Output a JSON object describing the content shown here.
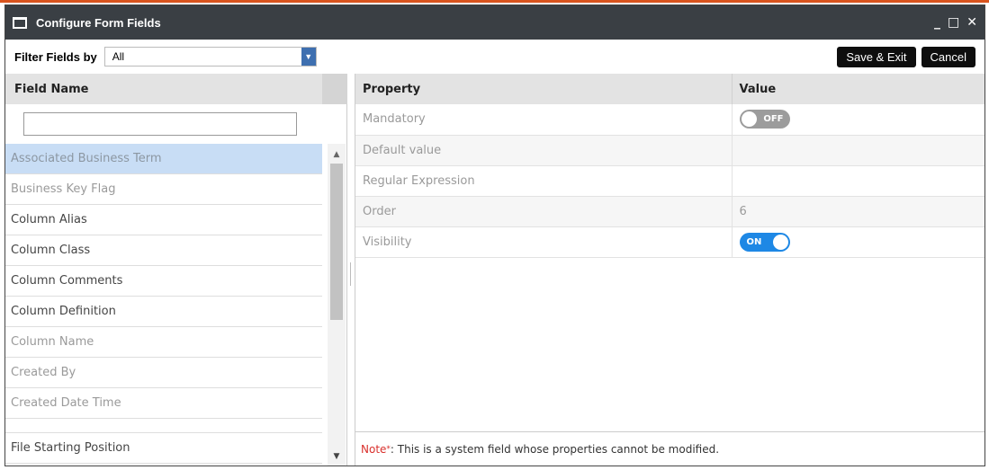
{
  "window": {
    "title": "Configure Form Fields",
    "minimize_glyph": "_",
    "maximize_glyph": "□",
    "close_glyph": "✕"
  },
  "toolbar": {
    "filter_label": "Filter Fields by",
    "filter_value": "All",
    "save_exit_label": "Save & Exit",
    "cancel_label": "Cancel"
  },
  "fields_panel": {
    "header": "Field Name",
    "search_value": "",
    "items": [
      {
        "label": "Associated Business Term",
        "state": "selected"
      },
      {
        "label": "Business Key Flag",
        "state": "muted"
      },
      {
        "label": "Column Alias",
        "state": "normal"
      },
      {
        "label": "Column Class",
        "state": "normal"
      },
      {
        "label": "Column Comments",
        "state": "normal"
      },
      {
        "label": "Column Definition",
        "state": "normal"
      },
      {
        "label": "Column Name",
        "state": "muted"
      },
      {
        "label": "Created By",
        "state": "muted"
      },
      {
        "label": "Created Date Time",
        "state": "muted"
      },
      {
        "label": "File Starting Position",
        "state": "normal"
      }
    ]
  },
  "properties": {
    "header_property": "Property",
    "header_value": "Value",
    "rows": [
      {
        "name": "Mandatory",
        "value": "OFF",
        "kind": "toggle-off"
      },
      {
        "name": "Default value",
        "value": "",
        "kind": "text"
      },
      {
        "name": "Regular Expression",
        "value": "",
        "kind": "text"
      },
      {
        "name": "Order",
        "value": "6",
        "kind": "text"
      },
      {
        "name": "Visibility",
        "value": "ON",
        "kind": "toggle-on"
      }
    ]
  },
  "note": {
    "label": "Note",
    "star": "*",
    "text": ": This is a system field whose properties cannot be modified."
  },
  "colors": {
    "accent": "#d9541e",
    "titlebar": "#3a3f44",
    "selected_row": "#c8ddf5",
    "toggle_on": "#1e88e5",
    "note_label": "#d9302c"
  }
}
